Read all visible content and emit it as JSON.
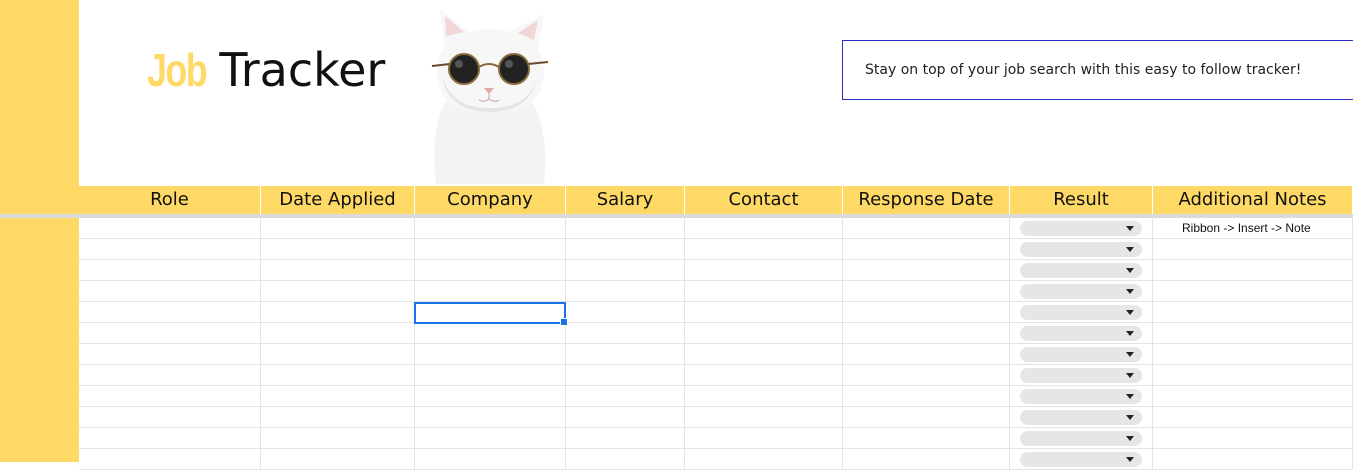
{
  "sheet": {
    "title_word1": "Job",
    "title_word2": " Tracker",
    "tagline": "Stay on top of your job search with this easy to follow tracker!",
    "image": "cat-with-sunglasses",
    "accent_color": "#ffd966",
    "columns": [
      "Role",
      "Date Applied",
      "Company",
      "Salary",
      "Contact",
      "Response Date",
      "Result",
      "Additional Notes"
    ],
    "result_dropdown_count": 12,
    "first_row_note": "Ribbon -> Insert -> Note",
    "selected_cell": "Company, row 5"
  }
}
